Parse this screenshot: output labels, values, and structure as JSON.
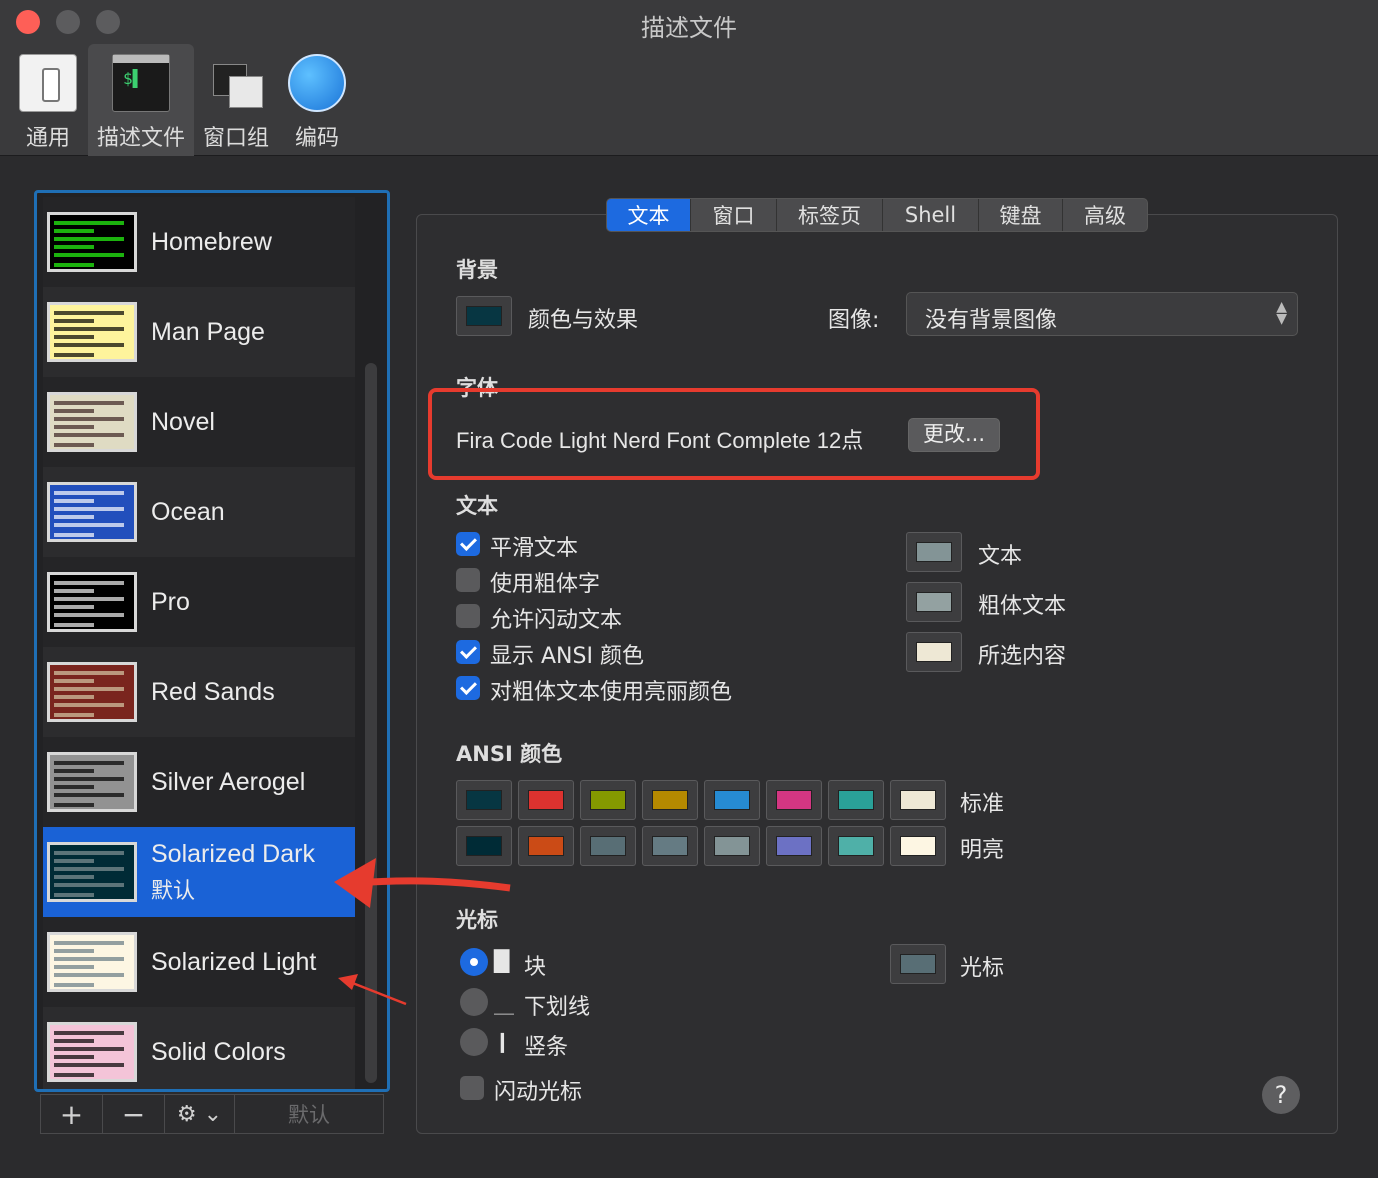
{
  "window": {
    "title": "描述文件"
  },
  "toolbar": {
    "items": [
      {
        "label": "通用"
      },
      {
        "label": "描述文件"
      },
      {
        "label": "窗口组"
      },
      {
        "label": "编码"
      }
    ],
    "terminal_glyph": "$▌"
  },
  "profiles": [
    {
      "name": "Homebrew",
      "bg": "#000000",
      "fg": "#28fe14"
    },
    {
      "name": "Man Page",
      "bg": "#fef49c",
      "fg": "#000000"
    },
    {
      "name": "Novel",
      "bg": "#dfdbc3",
      "fg": "#3b2322"
    },
    {
      "name": "Ocean",
      "bg": "#224fbc",
      "fg": "#ffffff"
    },
    {
      "name": "Pro",
      "bg": "#000000",
      "fg": "#f2f2f2"
    },
    {
      "name": "Red Sands",
      "bg": "#7a251e",
      "fg": "#d7c9a7"
    },
    {
      "name": "Silver Aerogel",
      "bg": "#929292",
      "fg": "#000000"
    },
    {
      "name": "Solarized Dark",
      "sub": "默认",
      "bg": "#002b36",
      "fg": "#839496",
      "selected": true
    },
    {
      "name": "Solarized Light",
      "bg": "#fdf6e3",
      "fg": "#657b83"
    },
    {
      "name": "Solid Colors",
      "bg": "#f4c4d8",
      "fg": "#000000"
    }
  ],
  "list_buttons": {
    "add": "+",
    "remove": "−",
    "gear": "⚙ ⌄",
    "default": "默认"
  },
  "tabs": [
    "文本",
    "窗口",
    "标签页",
    "Shell",
    "键盘",
    "高级"
  ],
  "background": {
    "heading": "背景",
    "color_label": "颜色与效果",
    "image_label": "图像:",
    "image_value": "没有背景图像",
    "color": "#073642"
  },
  "font": {
    "heading": "字体",
    "value": "Fira Code Light Nerd Font Complete 12点",
    "change_button": "更改..."
  },
  "text": {
    "heading": "文本",
    "options": [
      {
        "label": "平滑文本",
        "checked": true
      },
      {
        "label": "使用粗体字",
        "checked": false
      },
      {
        "label": "允许闪动文本",
        "checked": false
      },
      {
        "label": "显示 ANSI 颜色",
        "checked": true
      },
      {
        "label": "对粗体文本使用亮丽颜色",
        "checked": true
      }
    ],
    "colors": [
      {
        "label": "文本",
        "color": "#839496"
      },
      {
        "label": "粗体文本",
        "color": "#93a1a1"
      },
      {
        "label": "所选内容",
        "color": "#eee8d5"
      }
    ]
  },
  "ansi": {
    "heading": "ANSI 颜色",
    "normal_label": "标准",
    "bright_label": "明亮",
    "normal": [
      "#073642",
      "#dc322f",
      "#859900",
      "#b58900",
      "#268bd2",
      "#d33682",
      "#2aa198",
      "#eee8d5"
    ],
    "bright": [
      "#002b36",
      "#cb4b16",
      "#586e75",
      "#657b83",
      "#839496",
      "#6c71c4",
      "#4fb0a8",
      "#fdf6e3"
    ]
  },
  "cursor": {
    "heading": "光标",
    "options": [
      {
        "glyph": "█",
        "label": "块",
        "selected": true
      },
      {
        "glyph": "＿",
        "label": "下划线",
        "selected": false
      },
      {
        "glyph": "❙",
        "label": "竖条",
        "selected": false
      }
    ],
    "blink_label": "闪动光标",
    "color_label": "光标",
    "color": "#586e75"
  },
  "help": "?"
}
